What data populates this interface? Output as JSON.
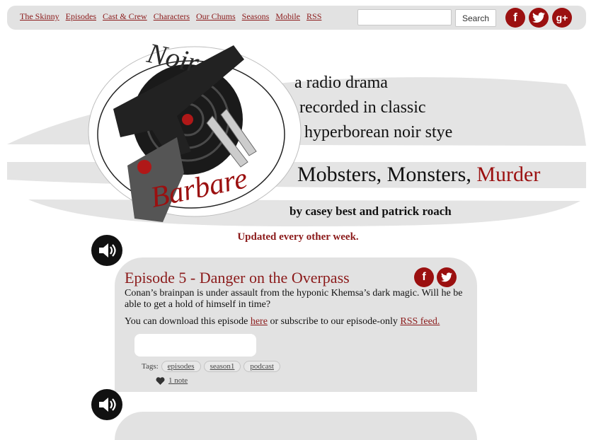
{
  "nav": {
    "items": [
      "The Skinny",
      "Episodes",
      "Cast & Crew",
      "Characters",
      "Our Chums",
      "Seasons",
      "Mobile",
      "RSS"
    ],
    "search_button": "Search",
    "social": [
      {
        "name": "facebook",
        "glyph": "f"
      },
      {
        "name": "twitter",
        "glyph": "t"
      },
      {
        "name": "google-plus",
        "glyph": "g+"
      }
    ]
  },
  "header": {
    "logo_word_1": "Noir",
    "logo_word_2": "Barbare",
    "tagline_1": "a radio drama",
    "tagline_2": "recorded in classic",
    "tagline_3": "hyperborean noir stye",
    "slogan_plain": "Mobsters, Monsters,",
    "slogan_red": "Murder",
    "byline": "by casey best and patrick roach",
    "updated": "Updated every other week."
  },
  "post": {
    "title": "Episode 5 - Danger on the Overpass",
    "body": "Conan’s brainpan is under assault from the hyponic Khemsa’s dark magic. Will he be able to get a hold of himself in time?",
    "download_prefix": "You can download this episode ",
    "download_link": "here",
    "download_middle": " or subscribe to our episode-only ",
    "rss_link": "RSS feed.",
    "tags_label": "Tags:",
    "tags": [
      "episodes",
      "season1",
      "podcast"
    ],
    "notes": "1 note",
    "share": [
      {
        "name": "facebook",
        "glyph": "f"
      },
      {
        "name": "twitter",
        "glyph": "t"
      }
    ]
  },
  "colors": {
    "accent": "#9b1010",
    "link": "#8b1a1a",
    "panel": "#e2e2e2"
  }
}
